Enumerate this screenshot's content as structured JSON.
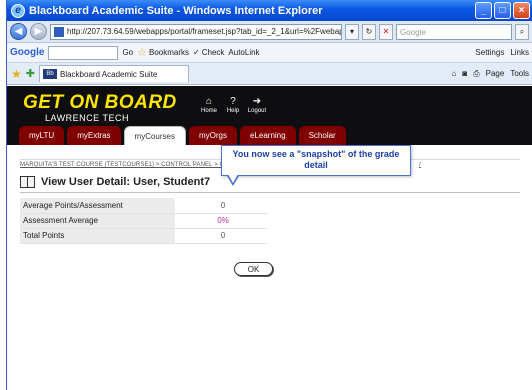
{
  "window": {
    "title": "Blackboard Academic Suite - Windows Internet Explorer",
    "buttons": [
      "_",
      "□",
      "×"
    ]
  },
  "address_bar": {
    "url": "http://207.73.64.59/webapps/portal/frameset.jsp?tab_id=_2_1&url=%2Fwebapps%",
    "search_placeholder": "Google"
  },
  "google_toolbar": {
    "label": "Google",
    "go": "Go",
    "bookmarks": "Bookmarks",
    "check": "Check",
    "autolink": "AutoLink",
    "settings": "Settings",
    "links": "Links"
  },
  "tabs": {
    "active_tab": "Blackboard Academic Suite",
    "favicon_text": "Bb",
    "page": "Page",
    "tools": "Tools"
  },
  "banner": {
    "brand_line1": "GET ON BOARD",
    "brand_line2": "LAWRENCE TECH",
    "top_links": [
      {
        "icon": "⌂",
        "label": "Home"
      },
      {
        "icon": "?",
        "label": "Help"
      },
      {
        "icon": "➜",
        "label": "Logout"
      }
    ]
  },
  "module_tabs": [
    {
      "label": "myLTU",
      "active": false
    },
    {
      "label": "myExtras",
      "active": false
    },
    {
      "label": "myCourses",
      "active": true
    },
    {
      "label": "myOrgs",
      "active": false
    },
    {
      "label": "eLearning",
      "active": false
    },
    {
      "label": "Scholar",
      "active": false
    }
  ],
  "breadcrumb": {
    "text": "MARQUITA'S TEST COURSE (TESTCOURSE1) > CONTROL PANEL > G",
    "tail": "/"
  },
  "page": {
    "heading": "View User Detail: User, Student7",
    "rows": [
      {
        "label": "Average Points/Assessment",
        "value": "0"
      },
      {
        "label": "Assessment Average",
        "value": "0%"
      },
      {
        "label": "Total Points",
        "value": "0"
      }
    ],
    "ok_label": "OK"
  },
  "callout": {
    "text": "You now see a \"snapshot\" of the grade detail"
  }
}
